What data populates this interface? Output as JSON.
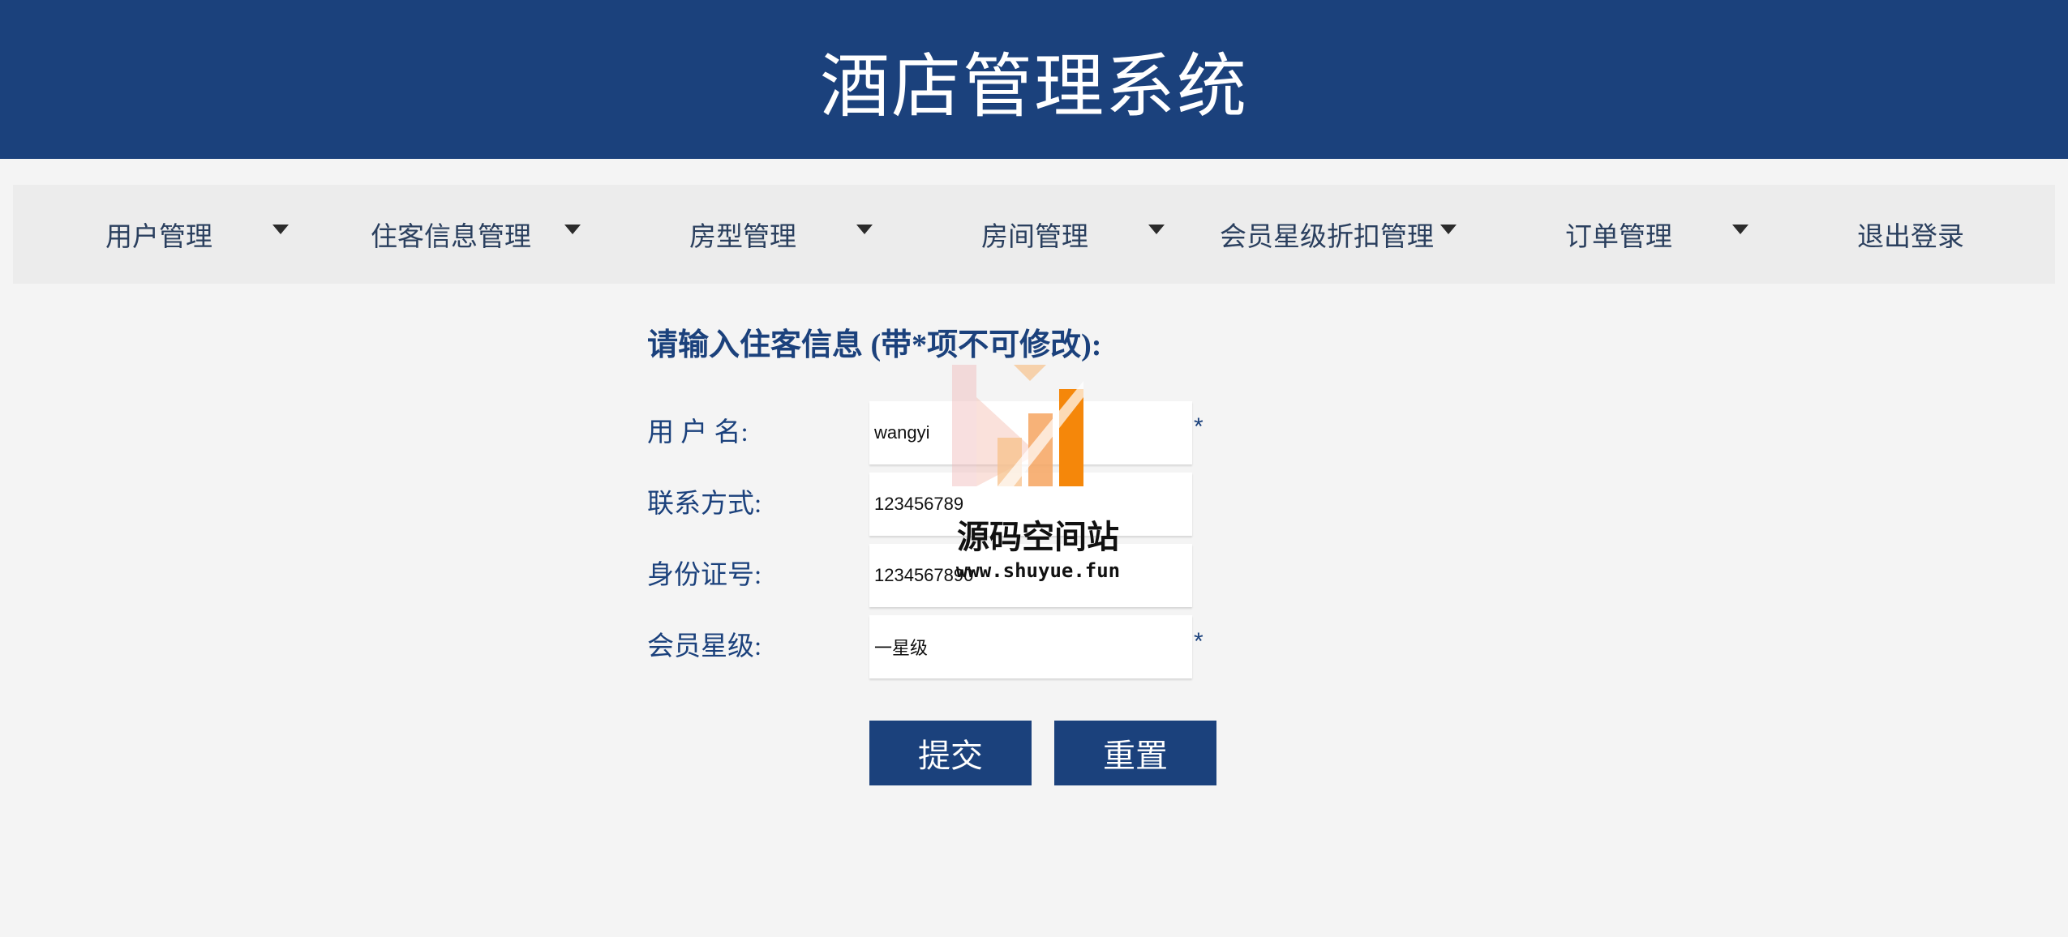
{
  "header": {
    "title": "酒店管理系统"
  },
  "nav": {
    "items": [
      {
        "label": "用户管理"
      },
      {
        "label": "住客信息管理"
      },
      {
        "label": "房型管理"
      },
      {
        "label": "房间管理"
      },
      {
        "label": "会员星级折扣管理"
      },
      {
        "label": "订单管理"
      },
      {
        "label": "退出登录"
      }
    ]
  },
  "form": {
    "title": "请输入住客信息 (带*项不可修改):",
    "username": {
      "label": "用 户 名:",
      "value": "wangyi",
      "required_mark": "*"
    },
    "contact": {
      "label": "联系方式:",
      "value": "123456789"
    },
    "id_number": {
      "label": "身份证号:",
      "value": "1234567890"
    },
    "member_level": {
      "label": "会员星级:",
      "value": "一星级",
      "required_mark": "*"
    },
    "submit_label": "提交",
    "reset_label": "重置"
  },
  "watermark": {
    "title": "源码空间站",
    "url": "www.shuyue.fun"
  },
  "colors": {
    "primary": "#1b417c",
    "background": "#f4f4f4",
    "nav_background": "#ececec",
    "watermark_orange": "#f5870a"
  }
}
